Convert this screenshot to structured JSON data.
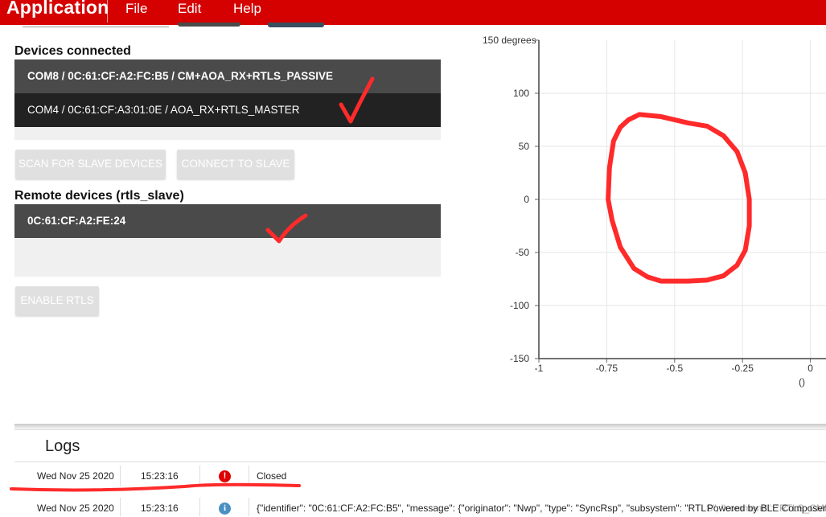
{
  "app": {
    "title": "Application",
    "menu": [
      "File",
      "Edit",
      "Help"
    ],
    "accent_color": "#d50000"
  },
  "devices_connected": {
    "title": "Devices connected",
    "items": [
      {
        "label": "COM8 / 0C:61:CF:A2:FC:B5 / CM+AOA_RX+RTLS_PASSIVE"
      },
      {
        "label": "COM4 / 0C:61:CF:A3:01:0E / AOA_RX+RTLS_MASTER"
      }
    ]
  },
  "actions": {
    "scan_label": "SCAN FOR SLAVE DEVICES",
    "connect_label": "CONNECT TO SLAVE",
    "enable_rtls_label": "ENABLE RTLS"
  },
  "remote_devices": {
    "title": "Remote devices (rtls_slave)",
    "items": [
      {
        "label": "0C:61:CF:A2:FE:24"
      }
    ]
  },
  "chart_data": {
    "type": "line",
    "title": "",
    "ylabel": "150 degrees",
    "xlabel": "()",
    "xlim": [
      -1,
      0
    ],
    "ylim": [
      -150,
      150
    ],
    "x_ticks": [
      "-1",
      "-0.75",
      "-0.5",
      "-0.25",
      "0"
    ],
    "y_ticks": [
      "100",
      "50",
      "0",
      "-50",
      "-100",
      "-150"
    ],
    "grid": true,
    "series": [
      {
        "color": "#ff2a2a",
        "x": [
          -0.63,
          -0.55,
          -0.45,
          -0.38,
          -0.32,
          -0.27,
          -0.24,
          -0.225,
          -0.225,
          -0.24,
          -0.27,
          -0.32,
          -0.38,
          -0.45,
          -0.55,
          -0.6,
          -0.65,
          -0.7,
          -0.73,
          -0.745,
          -0.74,
          -0.725,
          -0.7,
          -0.67,
          -0.63
        ],
        "y": [
          80,
          78,
          72,
          69,
          60,
          45,
          25,
          0,
          -25,
          -48,
          -62,
          -72,
          -76,
          -77,
          -77,
          -73,
          -65,
          -45,
          -20,
          0,
          30,
          55,
          68,
          75,
          80
        ]
      }
    ]
  },
  "logs": {
    "title": "Logs",
    "rows": [
      {
        "date": "Wed Nov 25 2020",
        "time": "15:23:16",
        "icon": "error-icon",
        "icon_glyph": "!",
        "message": "Closed"
      },
      {
        "date": "Wed Nov 25 2020",
        "time": "15:23:16",
        "icon": "info-icon",
        "icon_glyph": "i",
        "message": "{\"identifier\": \"0C:61:CF:A2:FC:B5\", \"message\": {\"originator\": \"Nwp\", \"type\": \"SyncRsp\", \"subsystem\": \"RTLS\", \"command\": \"RTLS_CMD_CONN_PARAMS\""
      }
    ]
  },
  "footer": {
    "powered_by": "Powered by BLE Composer"
  }
}
